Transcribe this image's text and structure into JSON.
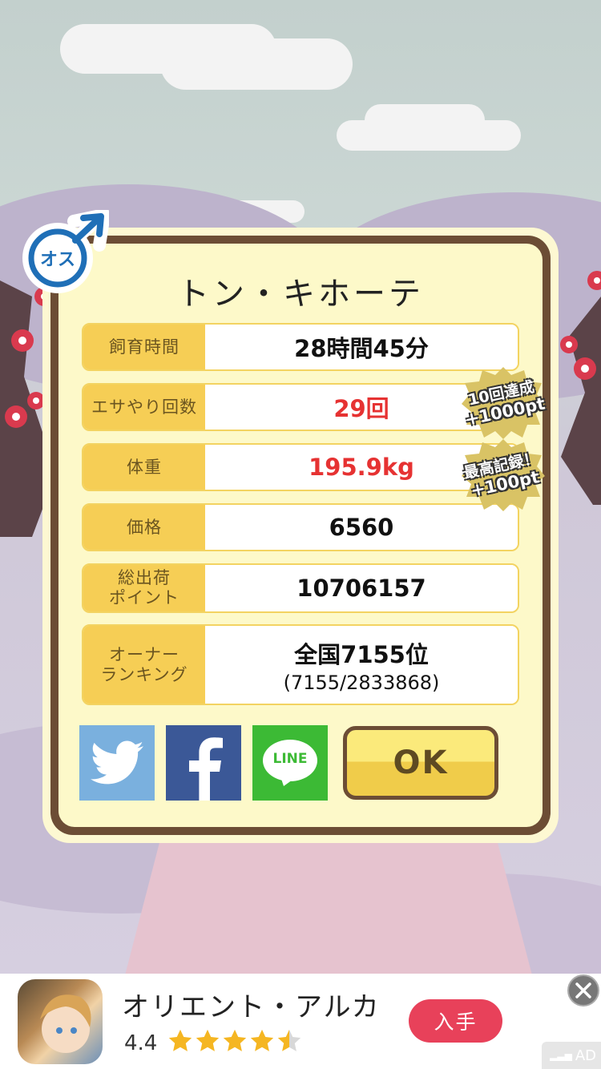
{
  "pet": {
    "name": "トン・キホーテ",
    "gender_label": "オス"
  },
  "stats": [
    {
      "label": "飼育時間",
      "value": "28時間45分",
      "highlight": false
    },
    {
      "label": "エサやり回数",
      "value": "29回",
      "highlight": true
    },
    {
      "label": "体重",
      "value": "195.9kg",
      "highlight": true
    },
    {
      "label": "価格",
      "value": "6560",
      "highlight": false
    },
    {
      "label_line1": "総出荷",
      "label_line2": "ポイント",
      "value": "10706157",
      "highlight": false
    },
    {
      "label_line1": "オーナー",
      "label_line2": "ランキング",
      "value": "全国7155位",
      "sub_value": "(7155/2833868)",
      "highlight": false
    }
  ],
  "badges": [
    {
      "line1": "10回達成",
      "line2": "+1000pt"
    },
    {
      "line1": "最高記録！",
      "line2": "+100pt"
    }
  ],
  "buttons": {
    "twitter": "twitter-share",
    "facebook": "facebook-share",
    "line_label": "LINE",
    "ok_label": "OK"
  },
  "ad": {
    "title": "オリエント・アルカ",
    "rating": "4.4",
    "rating_value": 4.4,
    "rating_max": 5,
    "get_label": "入手",
    "tag": "AD"
  },
  "colors": {
    "accent_yellow": "#f6ce55",
    "highlight_red": "#e63232",
    "frame_brown": "#6c4d35",
    "twitter_blue": "#7ab0de",
    "facebook_blue": "#3b5897",
    "line_green": "#3cba35",
    "ad_button": "#e8415a"
  }
}
